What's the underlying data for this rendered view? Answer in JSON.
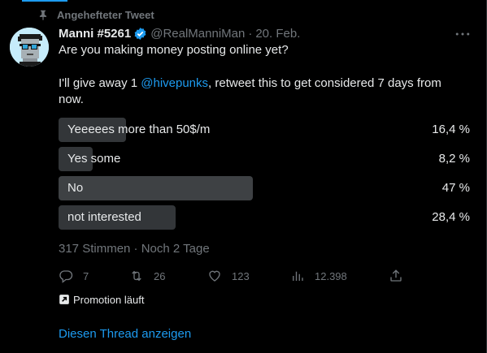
{
  "pinned": {
    "label": "Angehefteter Tweet",
    "icon": "pin-icon"
  },
  "author": {
    "display_name": "Manni #5261",
    "handle": "@RealManniMan",
    "date": "20. Feb.",
    "avatar_icon": "pixel-punk-avatar",
    "verified_icon": "verified-badge-icon",
    "verified_color": "#1d9bf0"
  },
  "tweet": {
    "line1": "Are you making money posting online yet?",
    "line2_prefix": "I'll give away 1 ",
    "mention": "@hivepunks",
    "line2_suffix": ", retweet this to get considered 7 days from",
    "line3": "now."
  },
  "poll": {
    "options": [
      {
        "label": "Yeeeees more than 50$/m",
        "percent_text": "16,4 %",
        "percent": 16.4,
        "winner": false
      },
      {
        "label": "Yes some",
        "percent_text": "8,2 %",
        "percent": 8.2,
        "winner": false
      },
      {
        "label": "No",
        "percent_text": "47 %",
        "percent": 47,
        "winner": true
      },
      {
        "label": "not interested",
        "percent_text": "28,4 %",
        "percent": 28.4,
        "winner": false
      }
    ],
    "votes": "317 Stimmen",
    "separator": "·",
    "remaining": "Noch 2 Tage"
  },
  "actions": {
    "reply_count": "7",
    "retweet_count": "26",
    "like_count": "123",
    "views_count": "12.398"
  },
  "promotion": {
    "label": "Promotion läuft",
    "icon": "arrow-up-right-icon"
  },
  "thread_link": "Diesen Thread anzeigen",
  "colors": {
    "accent": "#1d9bf0",
    "muted": "#71767b",
    "bar": "#333639",
    "bar_winner": "#3e4144",
    "background": "#000000"
  }
}
